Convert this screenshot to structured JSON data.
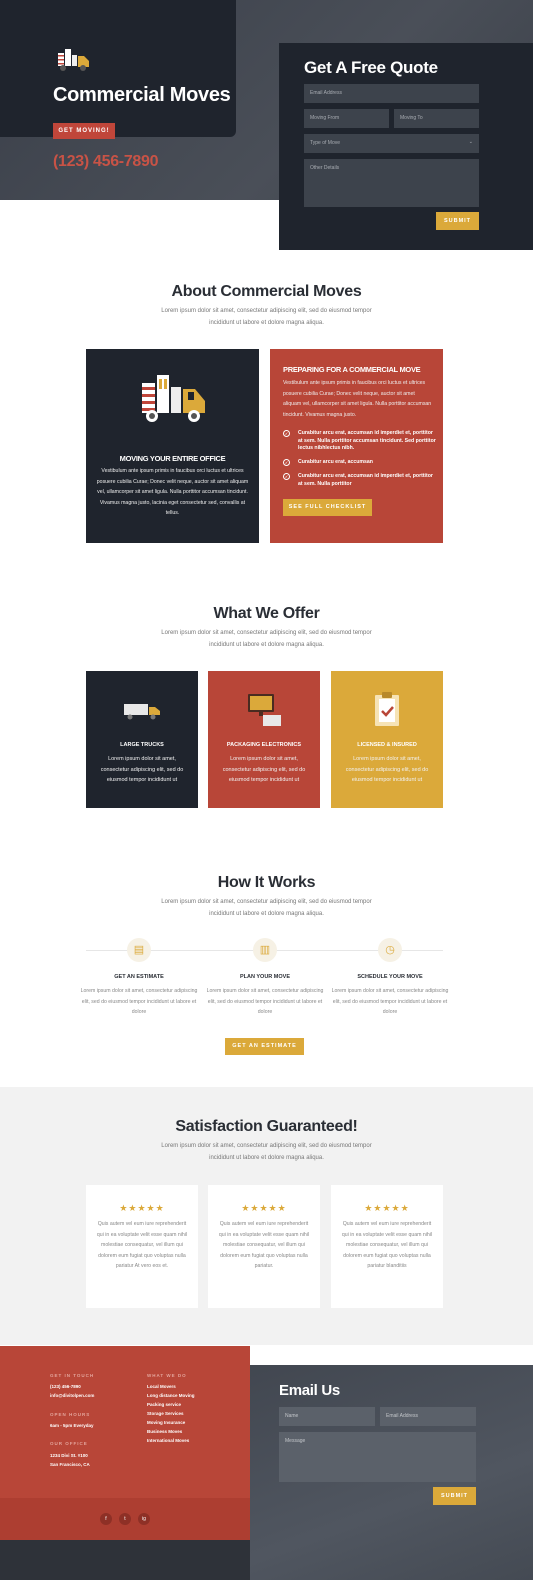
{
  "hero": {
    "title": "Commercial Moves",
    "button": "GET MOVING!",
    "phone": "(123) 456-7890"
  },
  "quote": {
    "title": "Get A Free Quote",
    "email_placeholder": "Email Address",
    "moving_from_placeholder": "Moving From",
    "moving_to_placeholder": "Moving To",
    "type_placeholder": "Type of Move",
    "details_placeholder": "Other Details",
    "submit": "SUBMIT"
  },
  "about": {
    "title": "About Commercial Moves",
    "text": "Lorem ipsum dolor sit amet, consectetur adipiscing elit, sed do eiusmod tempor incididunt ut labore et dolore magna aliqua.",
    "dark_card": {
      "title": "MOVING YOUR ENTIRE OFFICE",
      "text": "Vestibulum ante ipsum primis in faucibus orci luctus et ultrices posuere cubilia Curae; Donec velit neque, auctor sit amet aliquam vel, ullamcorper sit amet ligula. Nulla porttitor accumsan tincidunt. Vivamus magna justo, lacinia eget consectetur sed, convallis at tellus."
    },
    "red_card": {
      "title": "PREPARING FOR A COMMERCIAL MOVE",
      "text": "Vestibulum ante ipsum primis in faucibus orci luctus et ultrices posuere cubilia Curae; Donec velit neque, auctor sit amet aliquam vel, ullamcorper sit amet ligula. Nulla porttitor accumsan tincidunt. Vivamus magna justo.",
      "checks": [
        "Curabitur arcu erat, accumsan id imperdiet et, porttitor at sem. Nulla porttitor accumsan tincidunt. Sed porttitor lectus nibhlectus nibh.",
        "Curabitur arcu erat, accumsan",
        "Curabitur arcu erat, accumsan id imperdiet et, porttitor at sem. Nulla porttitor"
      ],
      "button": "SEE FULL CHECKLIST"
    }
  },
  "offer": {
    "title": "What We Offer",
    "text": "Lorem ipsum dolor sit amet, consectetur adipiscing elit, sed do eiusmod tempor incididunt ut labore et dolore magna aliqua.",
    "cards": [
      {
        "title": "LARGE TRUCKS",
        "text": "Lorem ipsum dolor sit amet, consectetur adipiscing elit, sed do eiusmod tempor incididunt ut"
      },
      {
        "title": "PACKAGING ELECTRONICS",
        "text": "Lorem ipsum dolor sit amet, consectetur adipiscing elit, sed do eiusmod tempor incididunt ut"
      },
      {
        "title": "LICENSED & INSURED",
        "text": "Lorem ipsum dolor sit amet, consectetur adipiscing elit, sed do eiusmod tempor incididunt ut"
      }
    ]
  },
  "how": {
    "title": "How It Works",
    "text": "Lorem ipsum dolor sit amet, consectetur adipiscing elit, sed do eiusmod tempor incididunt ut labore et dolore magna aliqua.",
    "steps": [
      {
        "icon": "document-icon",
        "title": "GET AN ESTIMATE",
        "text": "Lorem ipsum dolor sit amet, consectetur adipiscing elit, sed do eiusmod tempor incididunt ut labore et dolore"
      },
      {
        "icon": "clipboard-icon",
        "title": "PLAN YOUR MOVE",
        "text": "Lorem ipsum dolor sit amet, consectetur adipiscing elit, sed do eiusmod tempor incididunt ut labore et dolore"
      },
      {
        "icon": "clock-icon",
        "title": "SCHEDULE YOUR MOVE",
        "text": "Lorem ipsum dolor sit amet, consectetur adipiscing elit, sed do eiusmod tempor incididunt ut labore et dolore"
      }
    ],
    "button": "GET AN ESTIMATE"
  },
  "testimonials": {
    "title": "Satisfaction Guaranteed!",
    "text": "Lorem ipsum dolor sit amet, consectetur adipiscing elit, sed do eiusmod tempor incididunt ut labore et dolore magna aliqua.",
    "stars": "★★★★★",
    "cards": [
      "Quis autem vel eum iure reprehenderit qui in ea voluptate velit esse quam nihil molestiae consequatur, vel illum qui dolorem eum fugiat quo voluptas nulla pariatur At vero eos et.",
      "Quis autem vel eum iure reprehenderit qui in ea voluptate velit esse quam nihil molestiae consequatur, vel illum qui dolorem eum fugiat quo voluptas nulla pariatur.",
      "Quis autem vel eum iure reprehenderit qui in ea voluptate velit esse quam nihil molestiae consequatur, vel illum qui dolorem eum fugiat quo voluptas nulla pariatur blanditiis"
    ]
  },
  "footer": {
    "get_in_touch": "GET IN TOUCH",
    "phone": "(123) 456-7890",
    "email": "info@divitolpen.com",
    "open_hours": "OPEN HOURS",
    "hours": "6am - 5pm Everyday",
    "our_office": "OUR OFFICE",
    "address1": "1234 Divi St. #100",
    "address2": "San Francisco, CA",
    "what_we_do": "WHAT WE DO",
    "services": [
      "Local Movers",
      "Long distance Moving",
      "Packing service",
      "Storage Services",
      "Moving Insurance",
      "Business Moves",
      "International Moves"
    ],
    "social": [
      "f",
      "t",
      "ig"
    ]
  },
  "email_us": {
    "title": "Email Us",
    "name_placeholder": "Name",
    "email_placeholder": "Email Address",
    "message_placeholder": "Message",
    "submit": "SUBMIT"
  },
  "colors": {
    "dark": "#1f242d",
    "red": "#b84638",
    "gold": "#dba93a"
  }
}
